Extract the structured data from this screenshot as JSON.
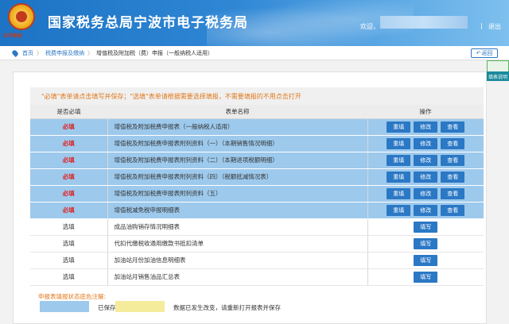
{
  "header": {
    "emblem_text": "中华税收",
    "title": "国家税务总局宁波市电子税务局",
    "welcome": "欢迎，",
    "separator": "|",
    "logout": "退出"
  },
  "breadcrumb": {
    "home": "首页",
    "sep": "〉",
    "section": "税费申报及缴纳",
    "current": "增值税及附加税（费）申报（一般纳税人适用）",
    "back_label": "返回"
  },
  "side_tab": {
    "label": "填表说明"
  },
  "notice": "\"必填\"表单请点击填写并保存；\"选填\"表单请根据需要选择填报，不需要填报的不用点击打开",
  "table": {
    "headers": [
      "是否必填",
      "表单名称",
      "操作"
    ],
    "rows": [
      {
        "required": "必填",
        "name": "增值税及附加税费申报表（一般纳税人适用）",
        "saved": true,
        "ops": [
          "重填",
          "修改",
          "查看"
        ]
      },
      {
        "required": "必填",
        "name": "增值税及附加税费申报表附列资料（一）（本期销售情况明细）",
        "saved": true,
        "ops": [
          "重填",
          "修改",
          "查看"
        ]
      },
      {
        "required": "必填",
        "name": "增值税及附加税费申报表附列资料（二）（本期进项税额明细）",
        "saved": true,
        "ops": [
          "重填",
          "修改",
          "查看"
        ]
      },
      {
        "required": "必填",
        "name": "增值税及附加税费申报表附列资料（四）（税额抵减情况表）",
        "saved": true,
        "ops": [
          "重填",
          "修改",
          "查看"
        ]
      },
      {
        "required": "必填",
        "name": "增值税及附加税费申报表附列资料（五）",
        "saved": true,
        "ops": [
          "重填",
          "修改",
          "查看"
        ]
      },
      {
        "required": "必填",
        "name": "增值税减免税申报明细表",
        "saved": true,
        "ops": [
          "重填",
          "修改",
          "查看"
        ]
      },
      {
        "required": "选填",
        "name": "成品油购销存情况明细表",
        "saved": false,
        "ops": [
          "填写"
        ]
      },
      {
        "required": "选填",
        "name": "代扣代缴税收通用缴款书抵扣清单",
        "saved": false,
        "ops": [
          "填写"
        ]
      },
      {
        "required": "选填",
        "name": "加油站月份加油信息明细表",
        "saved": false,
        "ops": [
          "填写"
        ]
      },
      {
        "required": "选填",
        "name": "加油站月销售油品汇总表",
        "saved": false,
        "ops": [
          "填写"
        ]
      }
    ]
  },
  "legend": {
    "title": "申报表填报状态底色注解:",
    "saved_label": "已保存",
    "changed_label": "数据已发生改变，请重新打开报表并保存"
  },
  "colors": {
    "saved_row": "#9dc9ec",
    "changed_row": "#f4ec9b",
    "button": "#2b78c5",
    "required_text": "#e02020",
    "notice_text": "#e0781c"
  }
}
